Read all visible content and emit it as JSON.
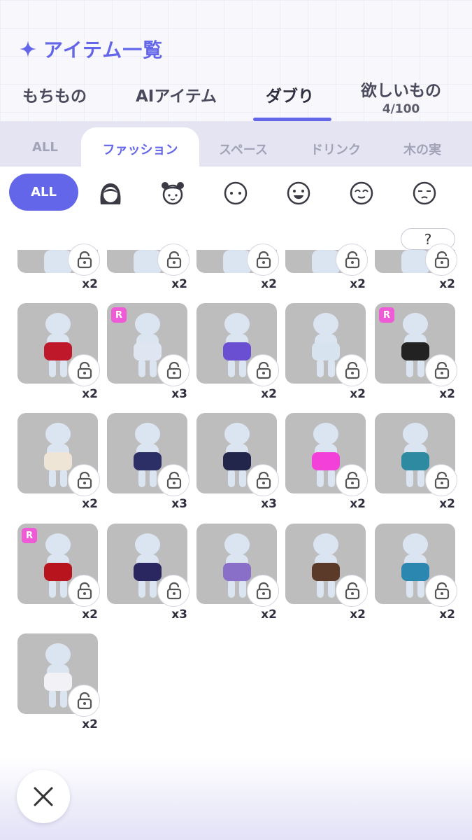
{
  "header": {
    "title": "アイテム一覧",
    "accent_color": "#6466e9",
    "tabs": [
      {
        "label": "もちもの"
      },
      {
        "label": "AIアイテム"
      },
      {
        "label": "ダブり",
        "active": true
      },
      {
        "label": "欲しいもの",
        "sub": "4/100"
      }
    ]
  },
  "categories": {
    "items": [
      "ALL",
      "ファッション",
      "スペース",
      "ドリンク",
      "木の実"
    ],
    "active": "ファッション"
  },
  "filters": {
    "all_label": "ALL",
    "icons": [
      "hair-icon",
      "head-accessory-icon",
      "face-eyes-icon",
      "face-smile-icon",
      "face-closed-eyes-icon",
      "face-sad-icon"
    ]
  },
  "grid": {
    "help_label": "?",
    "items": [
      {
        "name": "partial-item-1",
        "count": "x2",
        "rare": false
      },
      {
        "name": "partial-item-2",
        "count": "x2",
        "rare": false
      },
      {
        "name": "partial-item-3",
        "count": "x2",
        "rare": false
      },
      {
        "name": "partial-item-4",
        "count": "x2",
        "rare": false
      },
      {
        "name": "partial-item-5",
        "count": "x2",
        "rare": false
      },
      {
        "name": "red-skirt",
        "count": "x2",
        "rare": false
      },
      {
        "name": "yellow-eyes-face",
        "count": "x3",
        "rare": true,
        "badge": "R"
      },
      {
        "name": "neon-sneakers",
        "count": "x2",
        "rare": false
      },
      {
        "name": "pink-belt",
        "count": "x2",
        "rare": false
      },
      {
        "name": "black-loafers",
        "count": "x2",
        "rare": true,
        "badge": "R"
      },
      {
        "name": "ornate-skirt",
        "count": "x2",
        "rare": false
      },
      {
        "name": "navy-tshirt",
        "count": "x3",
        "rare": false
      },
      {
        "name": "navy-shorts",
        "count": "x3",
        "rare": false
      },
      {
        "name": "pink-crop-top",
        "count": "x2",
        "rare": false
      },
      {
        "name": "teal-ornate-top",
        "count": "x2",
        "rare": false
      },
      {
        "name": "red-fur-cuffs",
        "count": "x2",
        "rare": true,
        "badge": "R"
      },
      {
        "name": "navy-shoes",
        "count": "x3",
        "rare": false
      },
      {
        "name": "purple-kimono",
        "count": "x2",
        "rare": false
      },
      {
        "name": "brown-sleeves",
        "count": "x2",
        "rare": false
      },
      {
        "name": "teal-apron",
        "count": "x2",
        "rare": false
      },
      {
        "name": "white-tiger-suit",
        "count": "x2",
        "rare": false
      }
    ]
  },
  "close_label": "close"
}
